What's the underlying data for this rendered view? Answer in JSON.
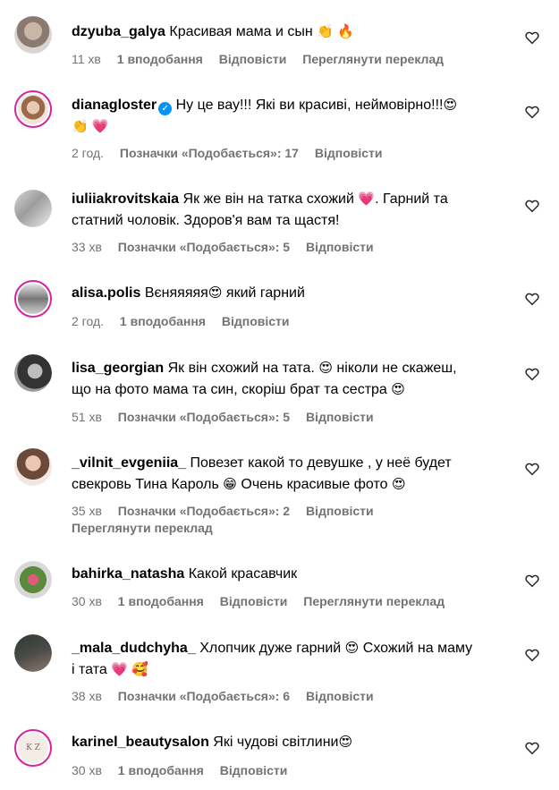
{
  "comments": [
    {
      "username": "dzyuba_galya",
      "text": "Красивая мама и сын",
      "emojis": "👏 🔥",
      "time": "11 хв",
      "likes": "1 вподобання",
      "reply": "Відповісти",
      "translate": "Переглянути переклад"
    },
    {
      "username": "dianagloster",
      "text": "Ну це вау!!! Які ви красиві, неймовірно!!!",
      "emojis": "😍",
      "line2": "👏 💗",
      "time": "2 год.",
      "likes": "Позначки «Подобається»: 17",
      "reply": "Відповісти"
    },
    {
      "username": "iuliiakrovitskaia",
      "text": "Як же він на татка схожий",
      "emojis": "💗",
      "text2": ". Гарний та",
      "line2": "статний чоловік. Здоров'я вам та щастя!",
      "time": "33 хв",
      "likes": "Позначки «Подобається»: 5",
      "reply": "Відповісти"
    },
    {
      "username": "alisa.polis",
      "text": "Вєняяяяя",
      "emojis": "😍",
      "text2": "який гарний",
      "time": "2 год.",
      "likes": "1 вподобання",
      "reply": "Відповісти"
    },
    {
      "username": "lisa_georgian",
      "text": "Як він схожий на тата.",
      "emojis": "😍",
      "text2": "ніколи не скажеш,",
      "line2": "що на фото мама та син, скоріш брат та сестра",
      "emoji2": "😍",
      "time": "51 хв",
      "likes": "Позначки «Подобається»: 5",
      "reply": "Відповісти"
    },
    {
      "username": "_vilnit_evgeniia_",
      "text": "Повезет какой то девушке , у неё будет",
      "line2": "свекровь Тина Кароль",
      "emoji2": "😁",
      "text3": "Очень красивые фото",
      "emoji3": "😍",
      "time": "35 хв",
      "likes": "Позначки «Подобається»: 2",
      "reply": "Відповісти",
      "translate": "Переглянути переклад"
    },
    {
      "username": "bahirka_natasha",
      "text": "Какой красавчик",
      "time": "30 хв",
      "likes": "1 вподобання",
      "reply": "Відповісти",
      "translate": "Переглянути переклад"
    },
    {
      "username": "_mala_dudchyha_",
      "text": "Хлопчик дуже гарний",
      "emojis": "😍",
      "text2": "Схожий на маму",
      "line2": "і тата",
      "emoji2": "💗 🥰",
      "time": "38 хв",
      "likes": "Позначки «Подобається»: 6",
      "reply": "Відповісти"
    },
    {
      "username": "karinel_beautysalon",
      "text": "Які чудові світлини",
      "emojis": "😍",
      "avatar_text": "K Z",
      "time": "30 хв",
      "likes": "1 вподобання",
      "reply": "Відповісти"
    }
  ],
  "icons": {
    "like": "heart-outline-icon",
    "verified": "verified-badge-icon"
  },
  "colors": {
    "meta": "#737373",
    "verified": "#0095f6",
    "story_ring": "#d6249f"
  }
}
